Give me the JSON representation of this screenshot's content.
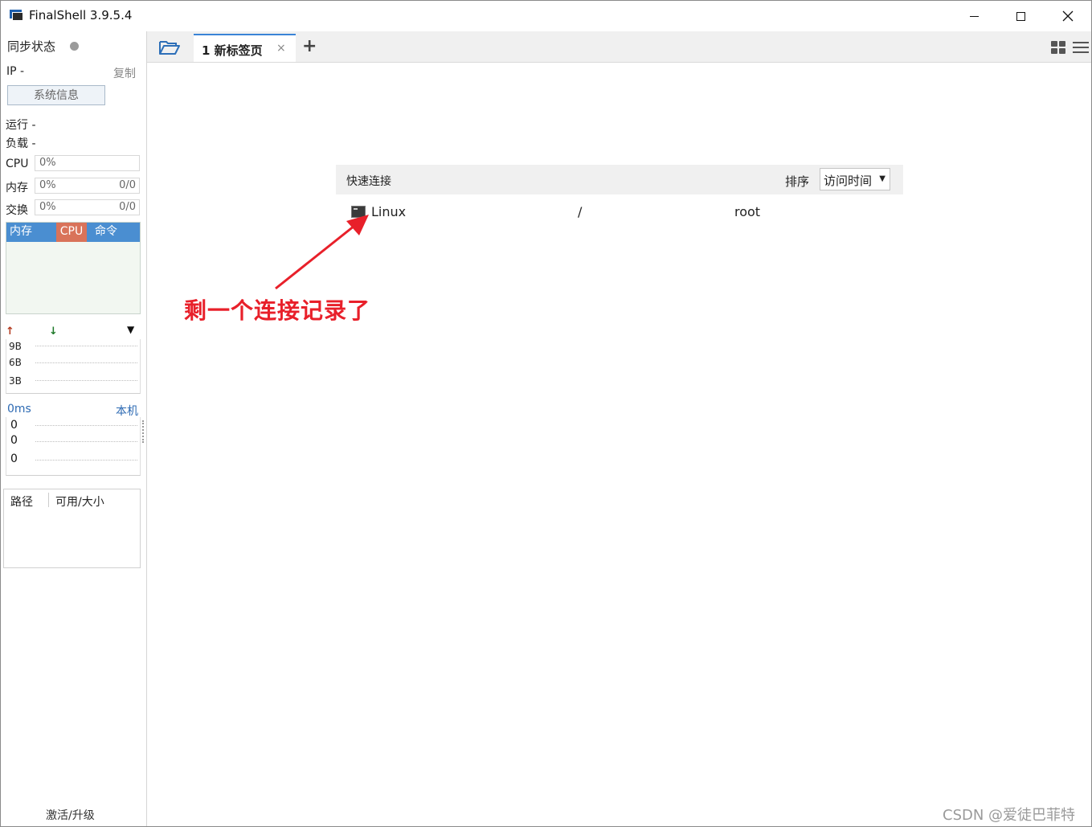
{
  "window": {
    "title": "FinalShell 3.9.5.4"
  },
  "sidebar": {
    "sync_label": "同步状态",
    "ip_label": "IP  -",
    "copy_label": "复制",
    "sysinfo_button": "系统信息",
    "run_label": "运行 -",
    "load_label": "负载 -",
    "metrics": [
      {
        "label": "CPU",
        "percent": "0%",
        "ratio": ""
      },
      {
        "label": "内存",
        "percent": "0%",
        "ratio": "0/0"
      },
      {
        "label": "交换",
        "percent": "0%",
        "ratio": "0/0"
      }
    ],
    "process_tabs": [
      "内存",
      "CPU",
      "命令"
    ],
    "network": {
      "up_arrow": "↑",
      "down_arrow": "↓",
      "dropdown": "▼",
      "ticks": [
        "9B",
        "6B",
        "3B"
      ]
    },
    "ping": {
      "latency": "0ms",
      "target": "本机",
      "ticks": [
        "0",
        "0",
        "0"
      ]
    },
    "disk": {
      "col_path": "路径",
      "col_size": "可用/大小"
    },
    "activate": "激活/升级"
  },
  "tabs": {
    "active_label": "1 新标签页",
    "close_glyph": "×",
    "add_glyph": "+"
  },
  "quick_connect": {
    "title": "快速连接",
    "sort_label": "排序",
    "sort_value": "访问时间",
    "connections": [
      {
        "name": "Linux",
        "path": "/",
        "user": "root"
      }
    ]
  },
  "annotation": {
    "text": "剩一个连接记录了",
    "color": "#e8202a"
  },
  "watermark": "CSDN @爱徒巴菲特",
  "colors": {
    "accent": "#3a84d6",
    "cpu_tab": "#d9735a",
    "proc_tabs_bg": "#4a8ed1"
  }
}
